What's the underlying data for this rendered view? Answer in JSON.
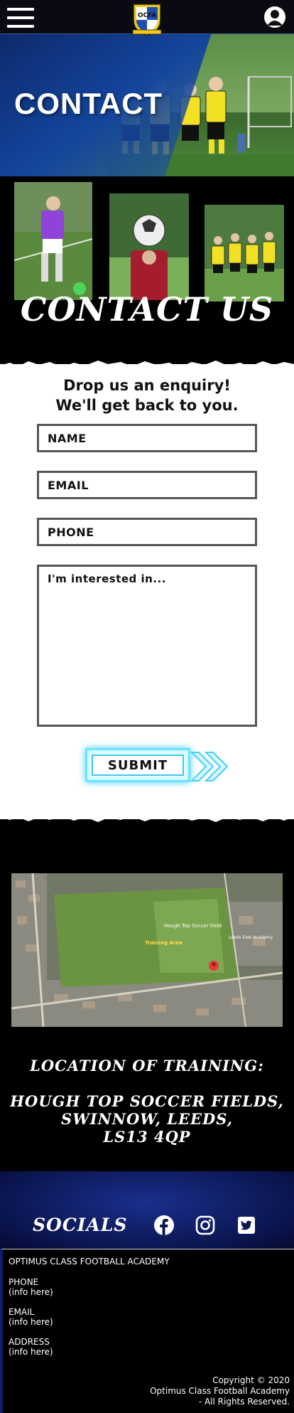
{
  "header": {
    "menu_icon": "hamburger-icon",
    "logo_text": "OCFA",
    "account_icon": "account-icon"
  },
  "hero": {
    "title": "CONTACT"
  },
  "photo_section": {
    "heading": "CONTACT US"
  },
  "form": {
    "heading_line1": "Drop us an enquiry!",
    "heading_line2": "We'll get back to you.",
    "name_placeholder": "NAME",
    "email_placeholder": "EMAIL",
    "phone_placeholder": "PHONE",
    "interest_placeholder": "I'm interested in...",
    "submit_label": "SUBMIT"
  },
  "map": {
    "labels": {
      "field": "Hough Top Soccer Field",
      "training": "Training Area",
      "school": "Leeds East Academy"
    }
  },
  "location": {
    "title": "LOCATION OF TRAINING:",
    "address_line1": "HOUGH TOP SOCCER FIELDS,",
    "address_line2": "SWINNOW, LEEDS,",
    "address_line3": "LS13 4QP"
  },
  "socials": {
    "title": "SOCIALS",
    "icons": [
      "facebook-icon",
      "instagram-icon",
      "twitter-icon"
    ]
  },
  "footer": {
    "org_name": "OPTIMUS CLASS FOOTBALL ACADEMY",
    "phone_label": "PHONE",
    "phone_value": "(info here)",
    "email_label": "EMAIL",
    "email_value": "(info here)",
    "address_label": "ADDRESS",
    "address_value": "(info here)",
    "copyright_line1": "Copyright © 2020",
    "copyright_line2": "Optimus Class Football Academy",
    "copyright_line3": "- All Rights Reserved."
  },
  "colors": {
    "accent_blue": "#31a8ff",
    "brand_navy": "#0d2a6b",
    "submit_glow": "#3fd0ff",
    "kit_yellow": "#f2e024"
  }
}
